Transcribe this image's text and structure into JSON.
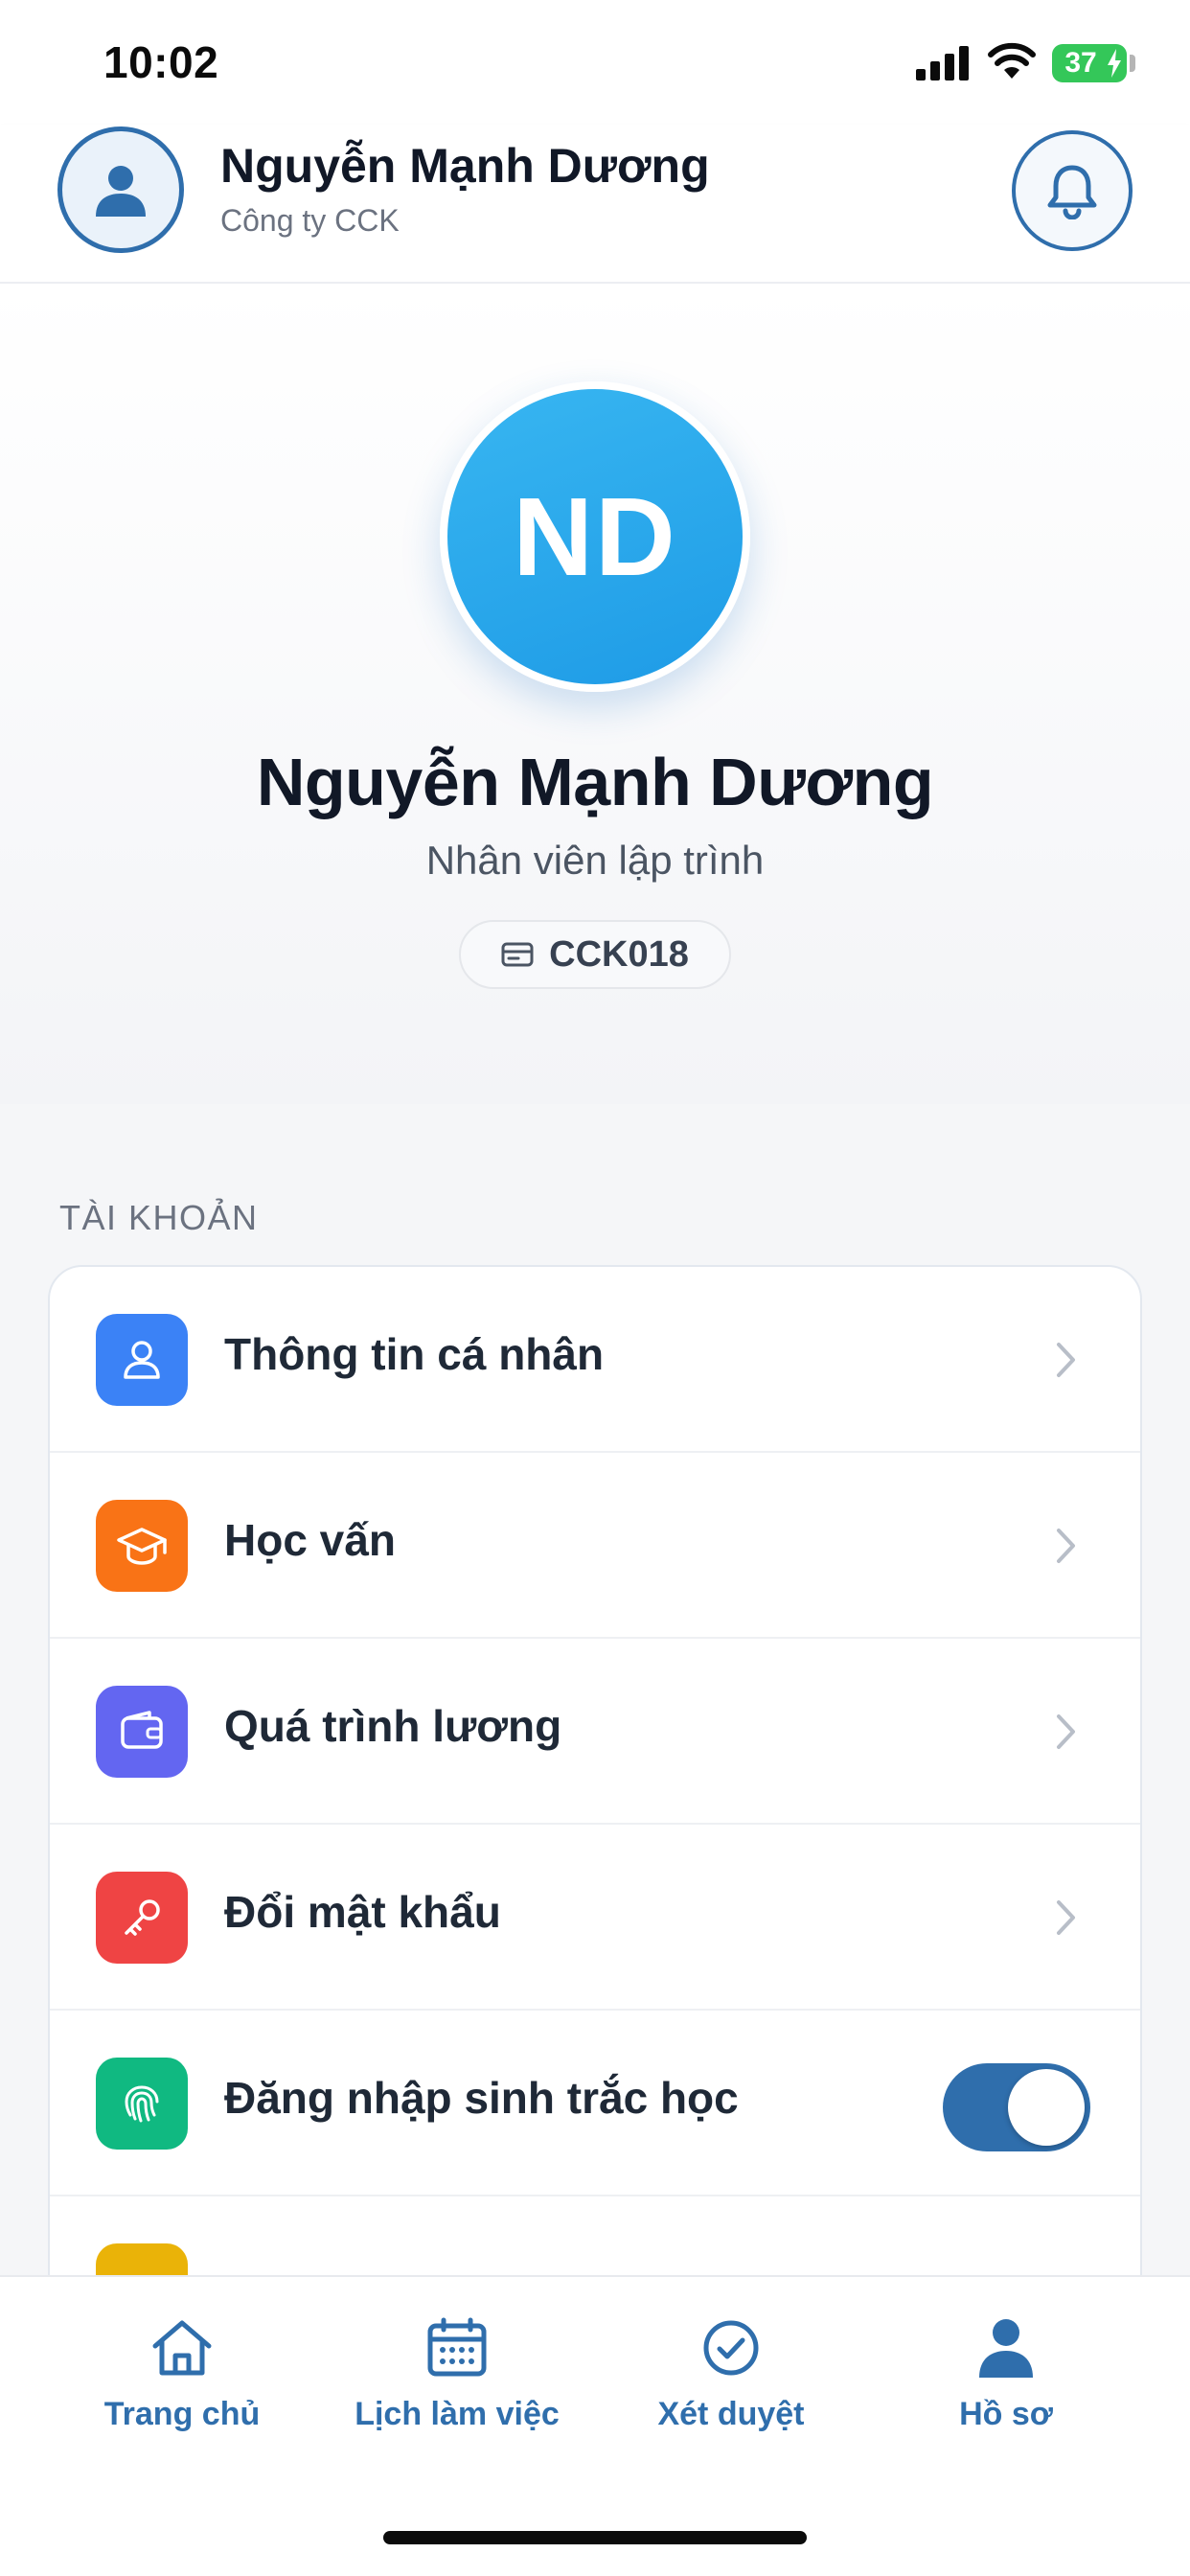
{
  "status_bar": {
    "time": "10:02",
    "battery": "37"
  },
  "header": {
    "name": "Nguyễn Mạnh Dương",
    "company": "Công ty CCK"
  },
  "profile": {
    "initials": "ND",
    "name": "Nguyễn Mạnh Dương",
    "role": "Nhân viên lập trình",
    "employee_id": "CCK018"
  },
  "account_section": {
    "title": "TÀI KHOẢN",
    "items": [
      {
        "label": "Thông tin cá nhân",
        "icon": "user-icon",
        "color": "#3b82f6"
      },
      {
        "label": "Học vấn",
        "icon": "graduation-cap-icon",
        "color": "#f97316"
      },
      {
        "label": "Quá trình lương",
        "icon": "wallet-icon",
        "color": "#6366f1"
      },
      {
        "label": "Đổi mật khẩu",
        "icon": "key-icon",
        "color": "#ef4444"
      },
      {
        "label": "Đăng nhập sinh trắc học",
        "icon": "fingerprint-icon",
        "color": "#10b981",
        "toggle_on": true
      }
    ]
  },
  "bottom_nav": {
    "items": [
      {
        "label": "Trang chủ",
        "icon": "home-icon"
      },
      {
        "label": "Lịch làm việc",
        "icon": "calendar-icon"
      },
      {
        "label": "Xét duyệt",
        "icon": "check-circle-icon"
      },
      {
        "label": "Hồ sơ",
        "icon": "profile-icon",
        "active": true
      }
    ]
  },
  "colors": {
    "primary": "#2f6eac",
    "avatar": "#1e9be6"
  }
}
